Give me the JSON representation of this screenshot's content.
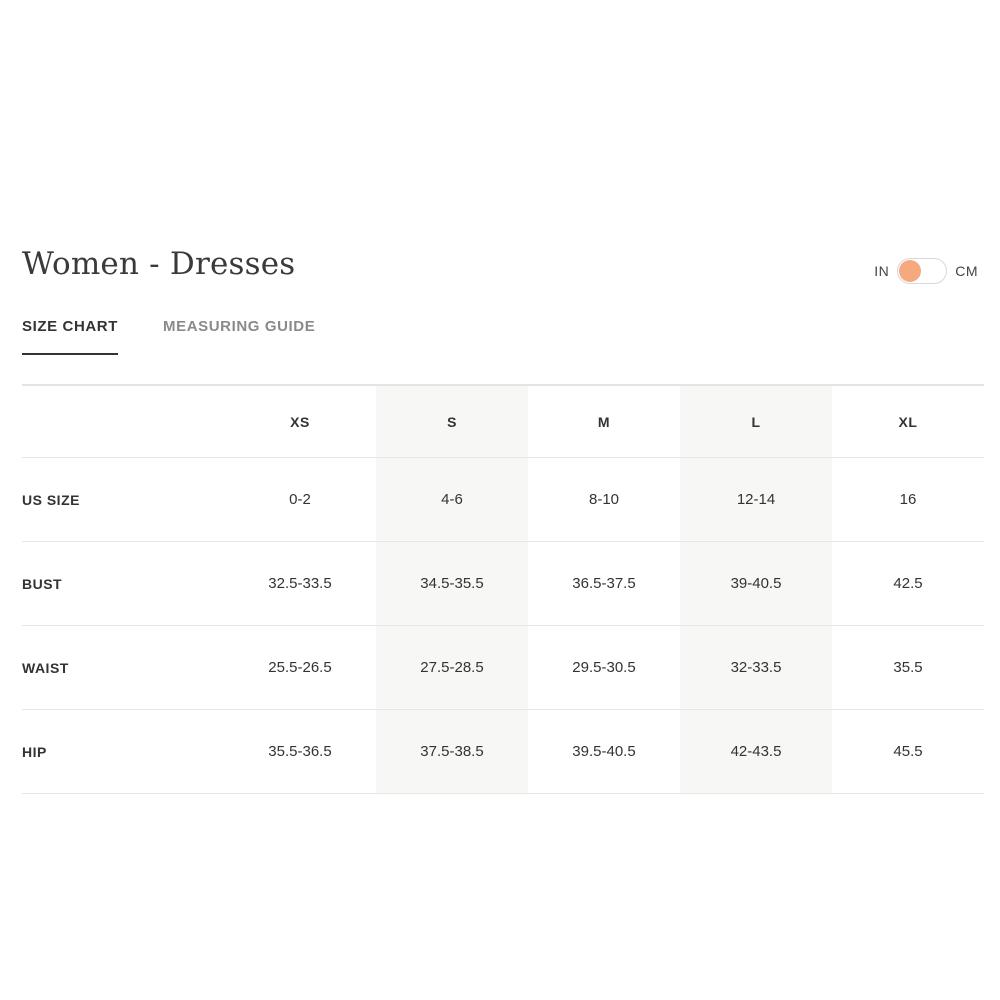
{
  "header": {
    "title": "Women - Dresses"
  },
  "unit_toggle": {
    "left_label": "IN",
    "right_label": "CM",
    "selected": "IN",
    "knob_color": "#f6a97f"
  },
  "tabs": [
    {
      "label": "SIZE CHART",
      "active": true
    },
    {
      "label": "MEASURING GUIDE",
      "active": false
    }
  ],
  "size_table": {
    "columns": [
      "XS",
      "S",
      "M",
      "L",
      "XL"
    ],
    "rows": [
      {
        "label": "US SIZE",
        "values": [
          "0-2",
          "4-6",
          "8-10",
          "12-14",
          "16"
        ]
      },
      {
        "label": "BUST",
        "values": [
          "32.5-33.5",
          "34.5-35.5",
          "36.5-37.5",
          "39-40.5",
          "42.5"
        ]
      },
      {
        "label": "WAIST",
        "values": [
          "25.5-26.5",
          "27.5-28.5",
          "29.5-30.5",
          "32-33.5",
          "35.5"
        ]
      },
      {
        "label": "HIP",
        "values": [
          "35.5-36.5",
          "37.5-38.5",
          "39.5-40.5",
          "42-43.5",
          "45.5"
        ]
      }
    ]
  }
}
